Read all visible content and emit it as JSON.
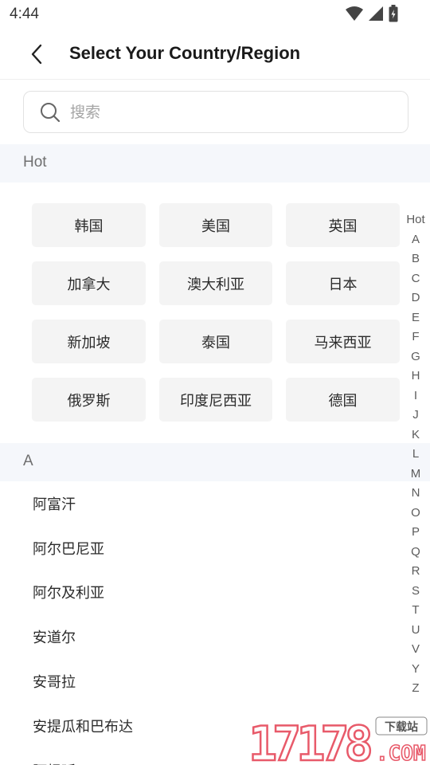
{
  "status_bar": {
    "time": "4:44"
  },
  "header": {
    "title": "Select Your Country/Region"
  },
  "search": {
    "placeholder": "搜索",
    "value": ""
  },
  "hot": {
    "label": "Hot",
    "items": [
      "韩国",
      "美国",
      "英国",
      "加拿大",
      "澳大利亚",
      "日本",
      "新加坡",
      "泰国",
      "马来西亚",
      "俄罗斯",
      "印度尼西亚",
      "德国"
    ]
  },
  "sections": [
    {
      "letter": "A",
      "items": [
        "阿富汗",
        "阿尔巴尼亚",
        "阿尔及利亚",
        "安道尔",
        "安哥拉",
        "安提瓜和巴布达",
        "阿根廷"
      ]
    }
  ],
  "index_bar": [
    "Hot",
    "A",
    "B",
    "C",
    "D",
    "E",
    "F",
    "G",
    "H",
    "I",
    "J",
    "K",
    "L",
    "M",
    "N",
    "O",
    "P",
    "Q",
    "R",
    "S",
    "T",
    "U",
    "V",
    "Y",
    "Z"
  ],
  "watermark": {
    "number": "17178",
    "tag": "下载站",
    "suffix": ".COM"
  },
  "colors": {
    "accent_watermark": "#e85a6a",
    "section_bg": "#f5f7fb",
    "chip_bg": "#f4f4f4"
  }
}
